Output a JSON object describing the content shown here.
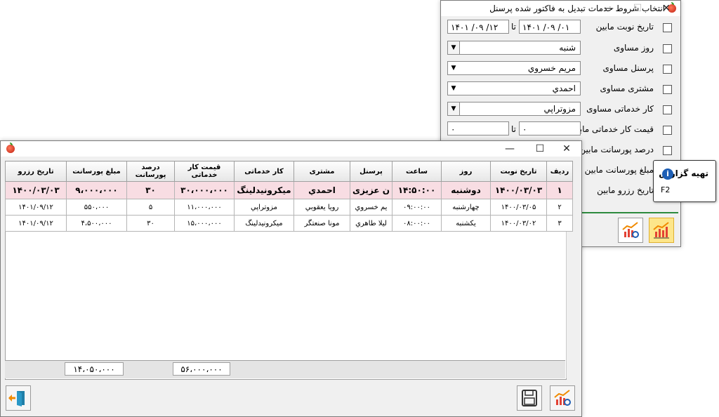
{
  "filter_window": {
    "title": "انتخاب شروط خدمات تبدیل به فاکتور شده پرسنل",
    "close_glyph": "✕",
    "max_glyph": "☐",
    "min_glyph": "—",
    "rows": [
      {
        "label": "تاریخ نوبت مابین",
        "from": "۱۴۰۱ /۰۹ /۰۱",
        "to_word": "تا",
        "to": "۱۴۰۱ /۰۹ /۱۲"
      },
      {
        "label": "روز مساوی",
        "value": "شنبه"
      },
      {
        "label": "پرسنل مساوی",
        "value": "مریم خسروي"
      },
      {
        "label": "مشتری مساوی",
        "value": "احمدي"
      },
      {
        "label": "کار خدماتی مساوی",
        "value": "مزوتراپي"
      },
      {
        "label": "قیمت کار خدماتی مابین",
        "from": "۰",
        "to_word": "تا",
        "to": "۰"
      },
      {
        "label": "درصد پورسانت مابین"
      },
      {
        "label": "مبلغ پورسانت مابین",
        "visible_part": "غ پورسانت مابین"
      },
      {
        "label": "تاریخ رزرو مابین",
        "visible_part": "یخ رزرو مابین"
      }
    ],
    "tooltip": {
      "title": "تهیه گزارش",
      "info_glyph": "i",
      "shortcut": "F2"
    }
  },
  "report_window": {
    "close_glyph": "✕",
    "max_glyph": "☐",
    "min_glyph": "—",
    "columns": [
      "ردیف",
      "تاریخ نوبت",
      "روز",
      "ساعت",
      "پرسنل",
      "مشتری",
      "کار خدماتی",
      "قیمت کار خدماتی",
      "درصد پورسانت",
      "مبلغ پورسانت",
      "تاریخ رزرو"
    ],
    "rows": [
      [
        "۱",
        "۱۴۰۰/۰۳/۰۳",
        "دوشنبه",
        "۱۴:۵۰:۰۰",
        "ن عزیزی",
        "احمدي",
        "میکرونیدلینگ",
        "۳۰،۰۰۰،۰۰۰",
        "۳۰",
        "۹،۰۰۰،۰۰۰",
        "۱۴۰۰/۰۳/۰۳"
      ],
      [
        "۲",
        "۱۴۰۰/۰۳/۰۵",
        "چهارشنبه",
        "۰۹:۰۰:۰۰",
        "یم خسروي",
        "رويا يعقوبي",
        "مزوتراپي",
        "۱۱،۰۰۰،۰۰۰",
        "۵",
        "۵۵۰،۰۰۰",
        "۱۴۰۱/۰۹/۱۲"
      ],
      [
        "۳",
        "۱۴۰۰/۰۳/۰۲",
        "یکشنبه",
        "۰۸:۰۰:۰۰",
        "ليلا طاهري",
        "مونا صنعتگر",
        "میکرونیدلینگ",
        "۱۵،۰۰۰،۰۰۰",
        "۳۰",
        "۴،۵۰۰،۰۰۰",
        "۱۴۰۱/۰۹/۱۲"
      ]
    ],
    "totals": {
      "commission_total": "۱۴،۰۵۰،۰۰۰",
      "price_total": "۵۶،۰۰۰،۰۰۰"
    }
  },
  "colors": {
    "selected_row": "#f8dde3",
    "active_button": "#fde68a",
    "info_blue": "#1e5fb5"
  },
  "icons": [
    "apple-logo-icon",
    "chart-report-icon",
    "chart-preview-icon",
    "save-disk-icon",
    "exit-door-icon",
    "info-icon"
  ]
}
